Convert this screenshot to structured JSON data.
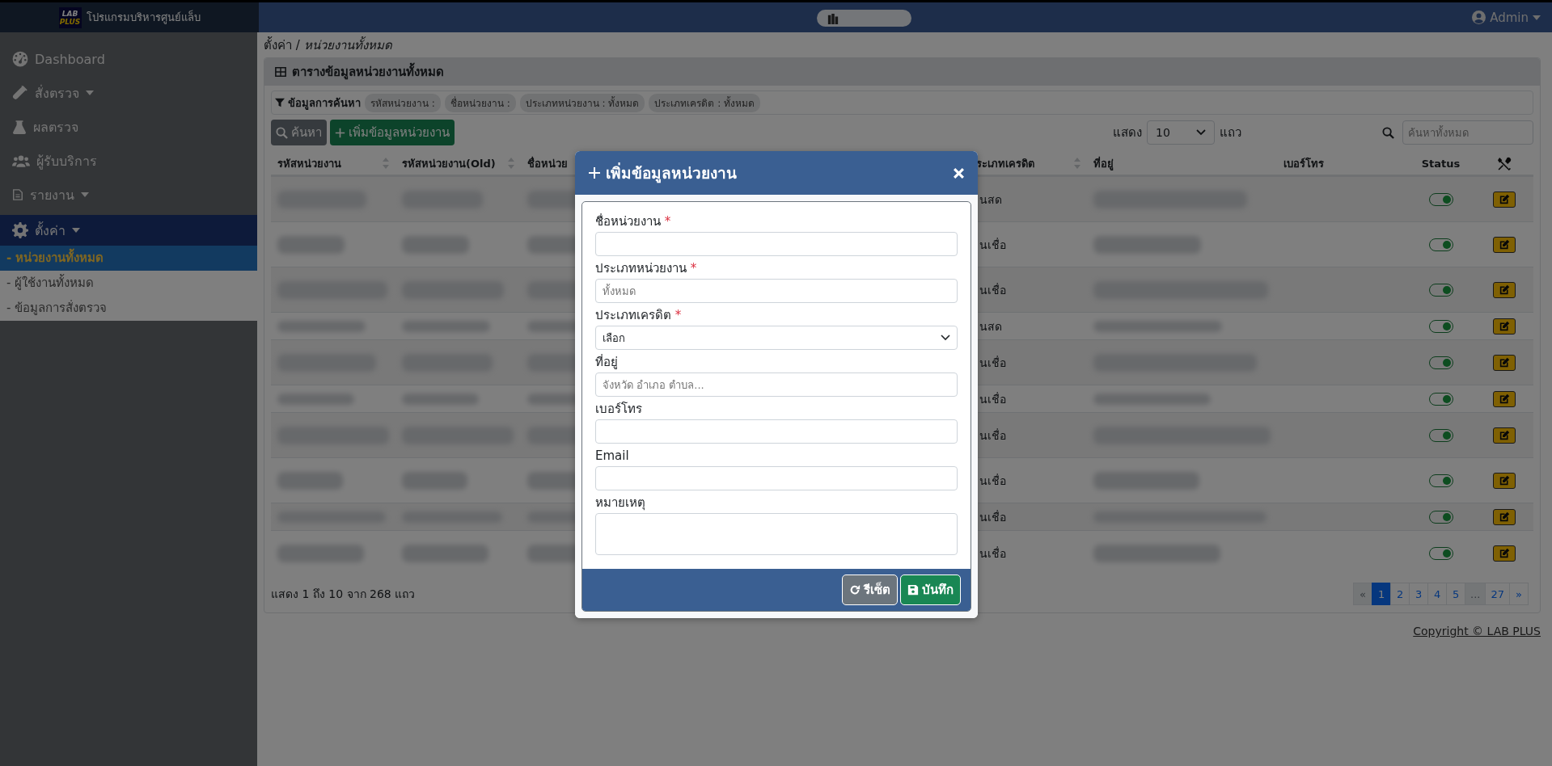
{
  "topbar": {
    "logo_text": [
      "LAB",
      "PLUS"
    ],
    "app_title": "โปรแกรมบริหารศูนย์แล็บ",
    "user": "Admin"
  },
  "sidebar": {
    "items": [
      {
        "label": "Dashboard",
        "expandable": false,
        "active": false
      },
      {
        "label": "สั่งตรวจ",
        "expandable": true,
        "active": false
      },
      {
        "label": "ผลตรวจ",
        "expandable": false,
        "active": false
      },
      {
        "label": "ผู้รับบริการ",
        "expandable": false,
        "active": false
      },
      {
        "label": "รายงาน",
        "expandable": true,
        "active": false
      },
      {
        "label": "ตั้งค่า",
        "expandable": true,
        "active": true,
        "children": [
          {
            "label": "- หน่วยงานทั้งหมด",
            "selected": true
          },
          {
            "label": "- ผู้ใช้งานทั้งหมด",
            "selected": false
          },
          {
            "label": "- ข้อมูลการสั่งตรวจ",
            "selected": false
          }
        ]
      }
    ]
  },
  "breadcrumb": "ตั้งค่า / *หน่วยงานทั้งหมด*",
  "card": {
    "title": "ตารางข้อมูลหน่วยงานทั้งหมด",
    "filter": {
      "label": "ข้อมูลการค้นหา",
      "chips": [
        "รหัสหน่วยงาน :",
        "ชื่อหน่วยงาน :",
        "ประเภทหน่วยงาน : ทั้งหมด",
        "ประเภทเครดิต : ทั้งหมด"
      ]
    },
    "search_button": "ค้นหา",
    "add_button": "เพิ่มข้อมูลหน่วยงาน",
    "page_length": {
      "before": "แสดง",
      "value": "10",
      "after": "แถว"
    },
    "search": {
      "placeholder": "ค้นหาทั้งหมด"
    },
    "table": {
      "columns": [
        {
          "label": "รหัสหน่วยงาน",
          "sortable": true
        },
        {
          "label": "รหัสหน่วยงาน(Old)",
          "sortable": true
        },
        {
          "label": "ชื่อหน่วย"
        },
        {
          "label": "ระเภทเครดิต",
          "sortable": true
        },
        {
          "label": "ที่อยู่",
          "sortable": false
        },
        {
          "label": "เบอร์โทร",
          "sortable": false
        },
        {
          "label": "Status",
          "sortable": false
        }
      ],
      "rows": [
        {
          "credit": "นสด",
          "status_on": true,
          "wrapped": true
        },
        {
          "credit": "นเชื่อ",
          "status_on": true,
          "wrapped": true
        },
        {
          "credit": "นเชื่อ",
          "status_on": true,
          "wrapped": true
        },
        {
          "credit": "นสด",
          "status_on": true,
          "wrapped": false
        },
        {
          "credit": "นเชื่อ",
          "status_on": true,
          "wrapped": true
        },
        {
          "credit": "นเชื่อ",
          "status_on": true,
          "wrapped": false
        },
        {
          "credit": "นเชื่อ",
          "status_on": true,
          "wrapped": true
        },
        {
          "credit": "นเชื่อ",
          "status_on": true,
          "wrapped": true
        },
        {
          "credit": "นเชื่อ",
          "status_on": true,
          "wrapped": false
        },
        {
          "credit": "นเชื่อ",
          "status_on": true,
          "wrapped": true
        }
      ]
    },
    "info": "แสดง 1 ถึง 10 จาก 268 แถว",
    "pages": [
      {
        "label": "«",
        "selected": false,
        "disabled": true
      },
      {
        "label": "1",
        "selected": true,
        "disabled": false
      },
      {
        "label": "2",
        "selected": false,
        "disabled": false
      },
      {
        "label": "3",
        "selected": false,
        "disabled": false
      },
      {
        "label": "4",
        "selected": false,
        "disabled": false
      },
      {
        "label": "5",
        "selected": false,
        "disabled": false
      },
      {
        "label": "...",
        "selected": false,
        "disabled": true
      },
      {
        "label": "27",
        "selected": false,
        "disabled": false
      },
      {
        "label": "»",
        "selected": false,
        "disabled": false
      }
    ]
  },
  "copyright": "Copyright © LAB PLUS",
  "modal": {
    "title": "เพิ่มข้อมูลหน่วยงาน",
    "required_mark": "*",
    "fields": [
      {
        "kind": "text",
        "label": "ชื่อหน่วยงาน",
        "required": true
      },
      {
        "kind": "text",
        "label": "ประเภทหน่วยงาน",
        "required": true,
        "placeholder": "ทั้งหมด"
      },
      {
        "kind": "select",
        "label": "ประเภทเครดิต",
        "required": true,
        "value": "เลือก"
      },
      {
        "kind": "text",
        "label": "ที่อยู่",
        "required": false,
        "placeholder": "จังหวัด อำเภอ ตำบล..."
      },
      {
        "kind": "text",
        "label": "เบอร์โทร",
        "required": false
      },
      {
        "kind": "text",
        "label": "Email",
        "required": false
      },
      {
        "kind": "textarea",
        "label": "หมายเหตุ",
        "required": false
      }
    ],
    "reset_button": "รีเซ็ต",
    "save_button": "บันทึก"
  }
}
